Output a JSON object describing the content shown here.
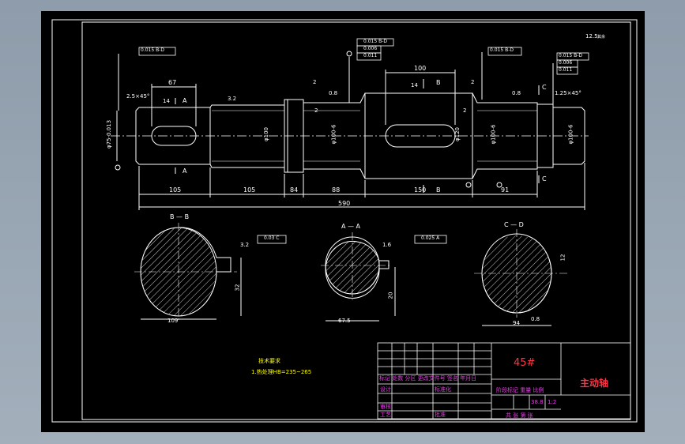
{
  "drawing": {
    "part_name": "主动轴",
    "material": "45#",
    "tech_title": "技术要求",
    "tech_req": "1.热处理HB=235~265",
    "roughness_corner": "12.5",
    "roughness_label": "其余"
  },
  "dims": {
    "d_67": "67",
    "d_100": "100",
    "d_105a": "105",
    "d_105b": "105",
    "d_84": "84",
    "d_88": "88",
    "d_150": "150",
    "d_91": "91",
    "d_590": "590",
    "d_chamfer_left": "2.5×45°",
    "d_chamfer_right": "1.25×45°",
    "d_14a": "14",
    "d_14b": "14",
    "d_2a": "2",
    "d_2b": "2",
    "d_2c": "2",
    "d_2d": "2",
    "r_08a": "0.8",
    "r_08b": "0.8",
    "r_08c": "0.8",
    "r_32a": "3.2",
    "r_32b": "3.2",
    "r_16": "1.6",
    "dia_left": "φ75-0.013",
    "dia_2": "φ100",
    "dia_3": "φ100-6",
    "dia_4": "φ120",
    "dia_5": "φ100-6",
    "dia_6": "φ100-6",
    "w_bb": "109",
    "w_aa": "67.5",
    "w_cc": "94",
    "key_bb": "32",
    "key_aa": "20",
    "key_cc": "12"
  },
  "tolerances": {
    "t1": "0.015 B-D",
    "t2a": "0.015 B-D",
    "t2b": "0.006",
    "t2c": "0.011",
    "t3": "0.015 B-D",
    "t4a": "0.015 B-D",
    "t4b": "0.006",
    "t4c": "0.011",
    "sym_bb": "0.03 C",
    "sym_aa": "0.025 A"
  },
  "section_labels": {
    "bb": "B — B",
    "aa": "A — A",
    "cc": "C — D",
    "a": "A",
    "b": "B",
    "c": "C",
    "d": "D"
  },
  "title_block": {
    "row_revision": "标记 处数 分区 更改文件号 签名 年月日",
    "designer": "设计",
    "standardize": "标准化",
    "review": "审核",
    "process": "工艺",
    "approve": "批准",
    "stage_label": "阶段标记 重量 比例",
    "weight": "38.8",
    "scale": "1:2",
    "sheets": "共 张 第 张"
  },
  "colors": {
    "outline": "#ffffff",
    "dim": "#ffffff",
    "frame": "#ffffff",
    "title_text": "#ff3344",
    "magenta": "#e040e0",
    "yellow": "#ffff00"
  }
}
